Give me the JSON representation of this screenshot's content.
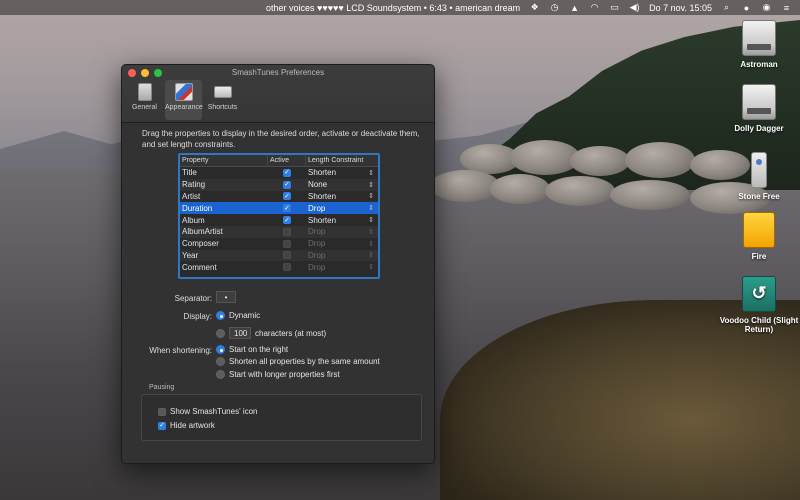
{
  "menubar": {
    "now_playing": "other voices ♥♥♥♥♥ LCD Soundsystem • 6:43 • american dream",
    "datetime": "Do 7 nov.  15:05",
    "icons": [
      "dropbox-icon",
      "time-machine-icon",
      "warning-icon",
      "wifi-icon",
      "screen-icon",
      "volume-icon",
      "search-icon",
      "user-icon",
      "siri-icon",
      "menu-list-icon"
    ]
  },
  "desktop": {
    "icons": [
      {
        "label": "Astroman",
        "kind": "hard-drive-icon"
      },
      {
        "label": "Dolly Dagger",
        "kind": "hard-drive-icon"
      },
      {
        "label": "Stone Free",
        "kind": "usb-drive-icon"
      },
      {
        "label": "Fire",
        "kind": "external-drive-icon"
      },
      {
        "label": "Voodoo Child (Slight Return)",
        "kind": "time-machine-drive-icon"
      }
    ]
  },
  "window": {
    "title": "SmashTunes Preferences",
    "tabs": [
      {
        "label": "General",
        "icon": "general-icon",
        "selected": false
      },
      {
        "label": "Appearance",
        "icon": "appearance-icon",
        "selected": true
      },
      {
        "label": "Shortcuts",
        "icon": "shortcuts-icon",
        "selected": false
      }
    ],
    "instructions": "Drag the properties to display in the desired order, activate or deactivate them, and set length constraints.",
    "table": {
      "headers": [
        "Property",
        "Active",
        "Length Constraint"
      ],
      "rows": [
        {
          "property": "Title",
          "active": true,
          "constraint": "Shorten"
        },
        {
          "property": "Rating",
          "active": true,
          "constraint": "None"
        },
        {
          "property": "Artist",
          "active": true,
          "constraint": "Shorten"
        },
        {
          "property": "Duration",
          "active": true,
          "constraint": "Drop",
          "selected": true
        },
        {
          "property": "Album",
          "active": true,
          "constraint": "Shorten"
        },
        {
          "property": "AlbumArtist",
          "active": false,
          "constraint": "Drop"
        },
        {
          "property": "Composer",
          "active": false,
          "constraint": "Drop"
        },
        {
          "property": "Year",
          "active": false,
          "constraint": "Drop"
        },
        {
          "property": "Comment",
          "active": false,
          "constraint": "Drop"
        }
      ]
    },
    "separator": {
      "label": "Separator:",
      "value": "•"
    },
    "display": {
      "label": "Display:",
      "option_dynamic": "Dynamic",
      "chars_value": "100",
      "chars_suffix": "characters (at most)",
      "selected": "Dynamic"
    },
    "shortening": {
      "label": "When shortening:",
      "options": [
        "Start on the right",
        "Shorten all properties by the same amount",
        "Start with longer properties first"
      ],
      "selected": "Start on the right"
    },
    "pausing": {
      "title": "Pausing",
      "show_icon_label": "Show SmashTunes' icon",
      "show_icon_checked": false,
      "hide_artwork_label": "Hide artwork",
      "hide_artwork_checked": true
    }
  },
  "colors": {
    "accent": "#2f7ee6",
    "selection": "#1b63d0",
    "window_bg": "#323232"
  }
}
